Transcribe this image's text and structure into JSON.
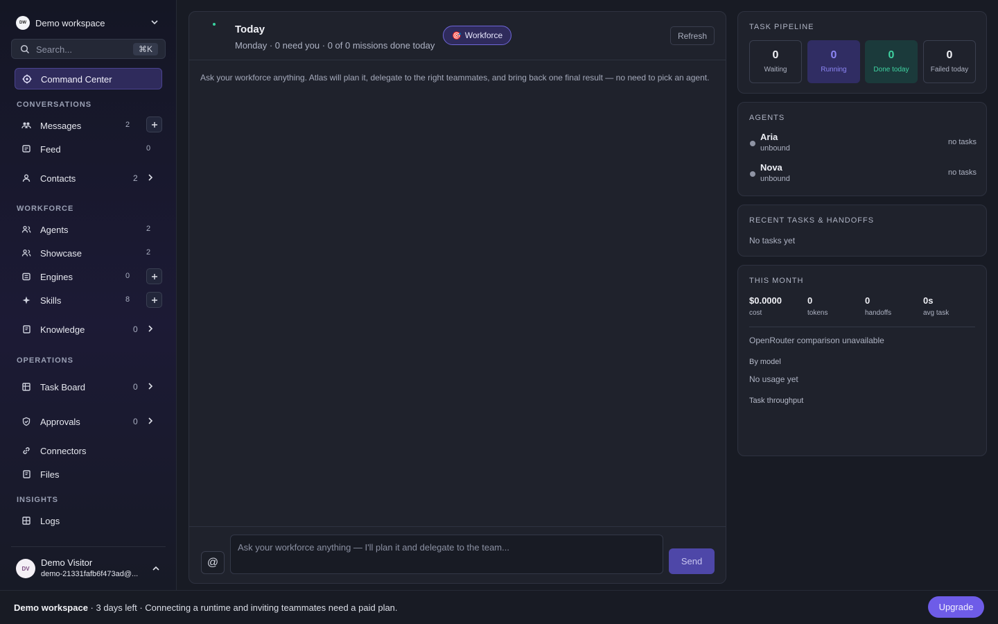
{
  "workspace": {
    "name": "Demo workspace",
    "initials": "DW"
  },
  "search": {
    "placeholder": "Search...",
    "shortcut": "⌘K"
  },
  "sidebar": {
    "active": {
      "label": "Command Center"
    },
    "sections": {
      "conversations": "CONVERSATIONS",
      "workforce": "WORKFORCE",
      "operations": "OPERATIONS",
      "insights": "INSIGHTS"
    },
    "items": {
      "messages": {
        "label": "Messages",
        "count": "2"
      },
      "feed": {
        "label": "Feed",
        "count": "0"
      },
      "contacts": {
        "label": "Contacts",
        "count": "2"
      },
      "agents": {
        "label": "Agents",
        "count": "2"
      },
      "showcase": {
        "label": "Showcase",
        "count": "2"
      },
      "engines": {
        "label": "Engines",
        "count": "0"
      },
      "skills": {
        "label": "Skills",
        "count": "8"
      },
      "knowledge": {
        "label": "Knowledge",
        "count": "0"
      },
      "taskboard": {
        "label": "Task Board",
        "count": "0"
      },
      "approvals": {
        "label": "Approvals",
        "count": "0"
      },
      "connectors": {
        "label": "Connectors"
      },
      "files": {
        "label": "Files"
      },
      "logs": {
        "label": "Logs"
      }
    }
  },
  "user": {
    "initials": "DV",
    "name": "Demo Visitor",
    "email": "demo-21331fafb6f473ad@..."
  },
  "main": {
    "title": "Today",
    "subtitle": "Monday · 0 need you · 0 of 0 missions done today",
    "workforce_label": "Workforce",
    "workforce_emoji": "🎯",
    "refresh_label": "Refresh",
    "hint": "Ask your workforce anything. Atlas will plan it, delegate to the right teammates, and bring back one final result — no need to pick an agent.",
    "composer_placeholder": "Ask your workforce anything — I'll plan it and delegate to the team...",
    "at_label": "@",
    "send_label": "Send"
  },
  "pipeline": {
    "title": "TASK PIPELINE",
    "waiting": {
      "value": "0",
      "label": "Waiting"
    },
    "running": {
      "value": "0",
      "label": "Running"
    },
    "done": {
      "value": "0",
      "label": "Done today"
    },
    "failed": {
      "value": "0",
      "label": "Failed today"
    }
  },
  "agents": {
    "title": "AGENTS",
    "list": [
      {
        "name": "Aria",
        "status": "unbound",
        "tasks": "no tasks"
      },
      {
        "name": "Nova",
        "status": "unbound",
        "tasks": "no tasks"
      }
    ]
  },
  "recent": {
    "title": "RECENT TASKS & HANDOFFS",
    "empty": "No tasks yet"
  },
  "month": {
    "title": "THIS MONTH",
    "cost": {
      "value": "$0.0000",
      "label": "cost"
    },
    "tokens": {
      "value": "0",
      "label": "tokens"
    },
    "handoffs": {
      "value": "0",
      "label": "handoffs"
    },
    "avg": {
      "value": "0s",
      "label": "avg task"
    },
    "openrouter": "OpenRouter comparison unavailable",
    "by_model": "By model",
    "no_usage": "No usage yet",
    "throughput": "Task throughput"
  },
  "banner": {
    "workspace": "Demo workspace",
    "message": " · 3 days left · Connecting a runtime and inviting teammates need a paid plan.",
    "upgrade_label": "Upgrade"
  },
  "colors": {
    "accent": "#6e5ce8",
    "success": "#3fd1a0",
    "running": "#8d86f5"
  }
}
